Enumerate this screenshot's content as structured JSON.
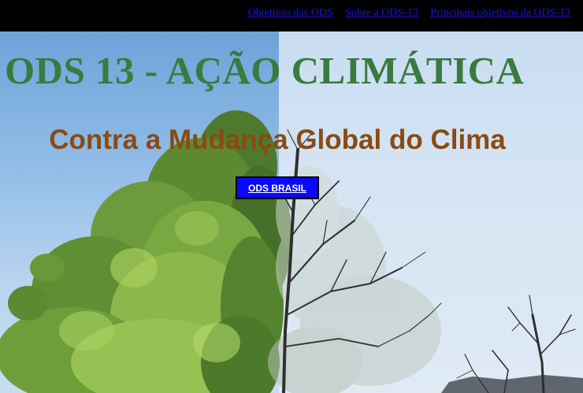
{
  "nav": {
    "links": [
      {
        "label": "Objetivos das ODS"
      },
      {
        "label": "Sobre a ODS-13"
      },
      {
        "label": "Principais objetivos da ODS-13"
      }
    ]
  },
  "hero": {
    "title": "ODS 13 - AÇÃO CLIMÁTICA",
    "subtitle": "Contra a Mudança Global do Clima",
    "button_label": "ODS BRASIL"
  },
  "colors": {
    "title": "#3a7a3e",
    "subtitle": "#8a4a12",
    "button": "#0a08ff",
    "nav_bg": "#000000",
    "nav_link": "#1a10ee"
  }
}
